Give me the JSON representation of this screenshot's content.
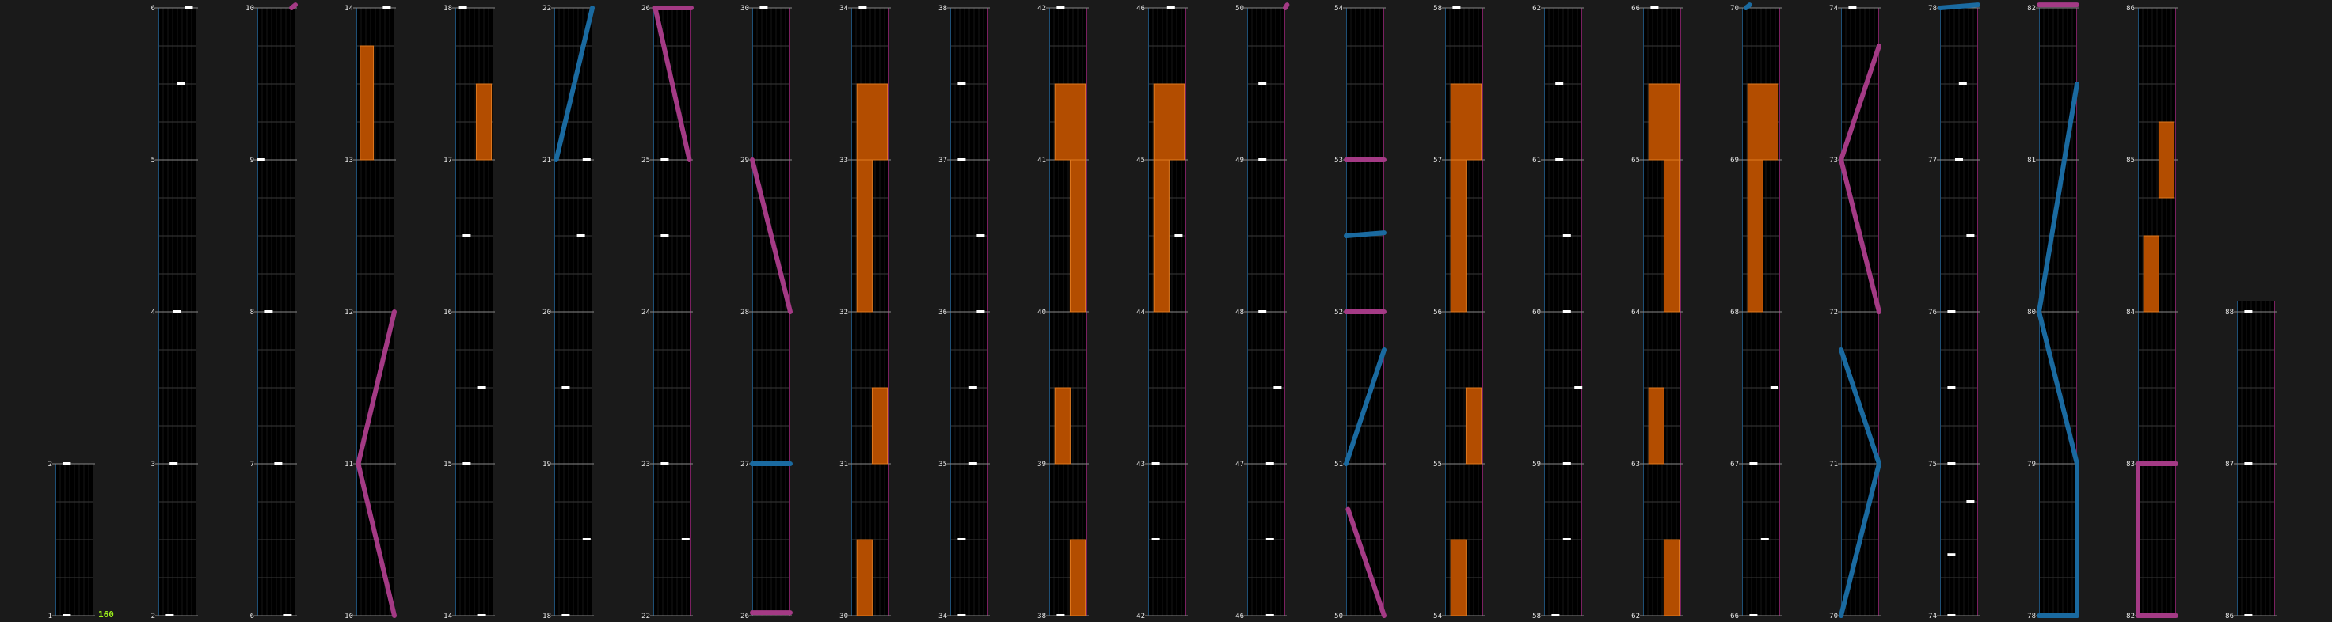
{
  "app": {
    "counter_value": "160"
  },
  "colors": {
    "background": "#1a1a1a",
    "column_fill": "#000000",
    "grid_line": "#3a3a3a",
    "boundary_line": "#888888",
    "left_rail": "#1e4f75",
    "right_rail": "#7a2060",
    "note_tap": "#ffffff",
    "hold_note": "#b34d00",
    "blue_slide": "#1a6aa0",
    "pink_slide": "#a43a85",
    "counter_text": "#9cf01a"
  },
  "icons": {
    "tap_note": "white-bar-note-icon",
    "hold_note": "orange-hold-note-icon",
    "slide_note": "diagonal-slide-icon"
  },
  "columns": [
    {
      "index": 0,
      "measures": [
        "1",
        "2"
      ]
    },
    {
      "index": 1,
      "measures": [
        "2",
        "3",
        "4",
        "5",
        "6"
      ]
    },
    {
      "index": 2,
      "measures": [
        "6",
        "7",
        "8",
        "9",
        "10"
      ]
    },
    {
      "index": 3,
      "measures": [
        "10",
        "11",
        "12",
        "13",
        "14"
      ]
    },
    {
      "index": 4,
      "measures": [
        "14",
        "15",
        "16",
        "17",
        "18"
      ]
    },
    {
      "index": 5,
      "measures": [
        "18",
        "19",
        "20",
        "21",
        "22"
      ]
    },
    {
      "index": 6,
      "measures": [
        "22",
        "23",
        "24",
        "25",
        "26"
      ]
    },
    {
      "index": 7,
      "measures": [
        "26",
        "27",
        "28",
        "29",
        "30"
      ]
    },
    {
      "index": 8,
      "measures": [
        "30",
        "31",
        "32",
        "33",
        "34"
      ]
    },
    {
      "index": 9,
      "measures": [
        "34",
        "35",
        "36",
        "37",
        "38"
      ]
    },
    {
      "index": 10,
      "measures": [
        "38",
        "39",
        "40",
        "41",
        "42"
      ]
    },
    {
      "index": 11,
      "measures": [
        "42",
        "43",
        "44",
        "45",
        "46"
      ]
    },
    {
      "index": 12,
      "measures": [
        "46",
        "47",
        "48",
        "49",
        "50"
      ]
    },
    {
      "index": 13,
      "measures": [
        "50",
        "51",
        "52",
        "53",
        "54"
      ]
    },
    {
      "index": 14,
      "measures": [
        "54",
        "55",
        "56",
        "57",
        "58"
      ]
    },
    {
      "index": 15,
      "measures": [
        "58",
        "59",
        "60",
        "61",
        "62"
      ]
    },
    {
      "index": 16,
      "measures": [
        "62",
        "63",
        "64",
        "65",
        "66"
      ]
    },
    {
      "index": 17,
      "measures": [
        "66",
        "67",
        "68",
        "69",
        "70"
      ]
    },
    {
      "index": 18,
      "measures": [
        "70",
        "71",
        "72",
        "73",
        "74"
      ]
    },
    {
      "index": 19,
      "measures": [
        "74",
        "75",
        "76",
        "77",
        "78"
      ]
    },
    {
      "index": 20,
      "measures": [
        "78",
        "79",
        "80",
        "81",
        "82"
      ]
    },
    {
      "index": 21,
      "measures": [
        "82",
        "83",
        "84",
        "85",
        "86"
      ]
    },
    {
      "index": 22,
      "measures": [
        "86",
        "87",
        "88"
      ]
    }
  ]
}
